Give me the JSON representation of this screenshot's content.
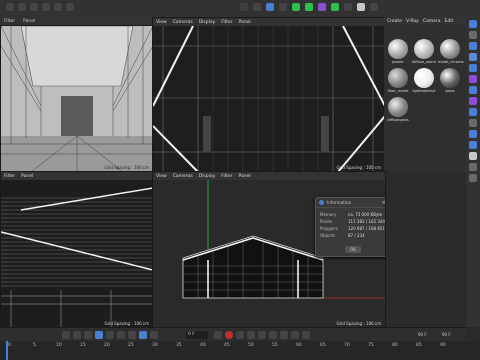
{
  "top_bar": {
    "menus_left": [
      "Filter",
      "Panel"
    ]
  },
  "viewport_top_right": {
    "menus": [
      "View",
      "Cameras",
      "Display",
      "Filter",
      "Panel"
    ],
    "tag": "Top",
    "grid": "Grid Spacing : 100 cm"
  },
  "viewport_top_left": {
    "grid": "Grid Spacing : 100 cm"
  },
  "viewport_bottom_left": {
    "menus": [
      "Filter",
      "Panel"
    ],
    "grid": "Grid Spacing : 100 cm"
  },
  "viewport_bottom_right": {
    "menus": [
      "View",
      "Cameras",
      "Display",
      "Filter",
      "Panel"
    ],
    "tag": "Front",
    "grid": "Grid Spacing : 100 cm"
  },
  "material_panel": {
    "menus": [
      "Create",
      "V-Ray",
      "Camera",
      "Edit"
    ],
    "materials": [
      "plastic",
      "diffuse_warm",
      "metal_chrome",
      "floor_mixed",
      "lightmaterial",
      "glass",
      "diffuseglass"
    ]
  },
  "info_dialog": {
    "title": "Information",
    "rows": [
      {
        "k": "Memory",
        "v": "ca. 73 000 KByte"
      },
      {
        "k": "Points",
        "v": "117 383 / 162 344"
      },
      {
        "k": "Polygons",
        "v": "120 987 / 168 851"
      },
      {
        "k": "Objects",
        "v": "87 / 234"
      }
    ],
    "ok": "OK"
  },
  "timeline": {
    "frame_field": "0 F",
    "ticks": [
      "0",
      "5",
      "10",
      "15",
      "20",
      "25",
      "30",
      "35",
      "40",
      "45",
      "50",
      "55",
      "60",
      "65",
      "70",
      "75",
      "80",
      "85",
      "90"
    ],
    "end_left": "90 F",
    "end_right": "90 F"
  },
  "colors": {
    "accent": "#4a7fd6",
    "red": "#c03030",
    "green": "#2fbf4f"
  }
}
